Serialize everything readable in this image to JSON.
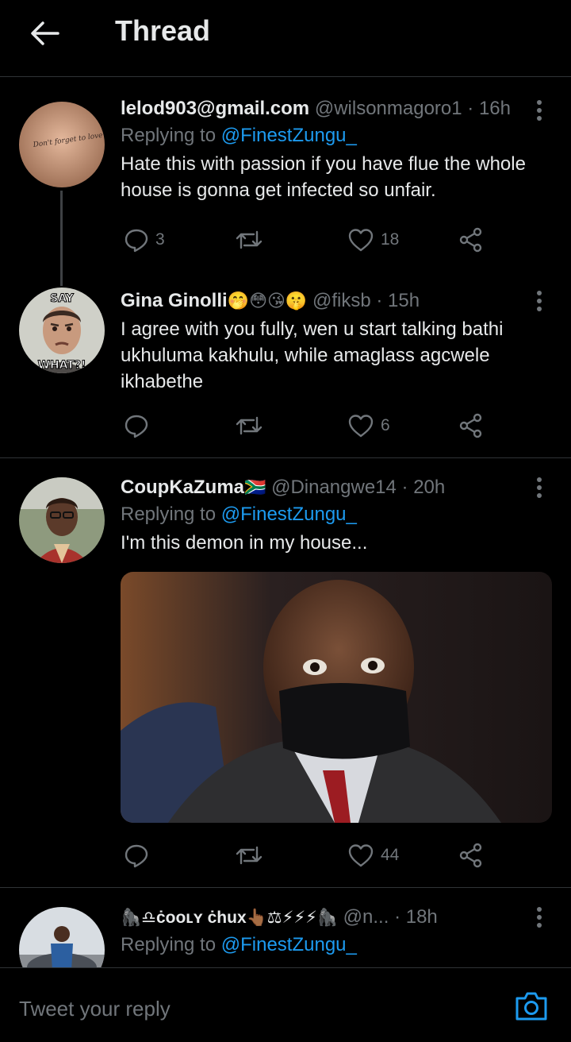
{
  "header": {
    "title": "Thread"
  },
  "tweets": [
    {
      "name": "lelod903@gmail.com",
      "name_emojis": "",
      "handle": "@wilsonmagoro1",
      "time": "· 16h",
      "reply_prefix": "Replying to ",
      "reply_to": "@FinestZungu_",
      "text": "Hate this with passion if you have flue the whole house is gonna get infected  so unfair.",
      "replies": "3",
      "retweets": "",
      "likes": "18",
      "avatar_text": "Don't forget to love yourself"
    },
    {
      "name": "Gina Ginolli",
      "name_emojis": "🤭😳😘🤫",
      "handle": "@fiksb",
      "time": "· 15h",
      "text": "I agree with you fully, wen u start talking bathi ukhuluma kakhulu, while amaglass agcwele ikhabethe",
      "replies": "",
      "retweets": "",
      "likes": "6",
      "avatar_top": "SAY",
      "avatar_bottom": "WHAT?!"
    },
    {
      "name": "CoupKaZuma",
      "name_emojis": "🇿🇦",
      "handle": "@Dinangwe14",
      "time": "· 20h",
      "reply_prefix": "Replying to ",
      "reply_to": "@FinestZungu_",
      "text": "I'm this demon in my house...",
      "replies": "",
      "retweets": "",
      "likes": "44"
    },
    {
      "name": "🦍♎ċooʟʏ ċhux👆🏾⚖⚡⚡⚡🦍",
      "handle": "@n...",
      "time": "· 18h",
      "reply_prefix": "Replying to ",
      "reply_to": "@FinestZungu_"
    }
  ],
  "composer": {
    "placeholder": "Tweet your reply"
  },
  "colors": {
    "accent": "#1d9bf0",
    "muted": "#71767b",
    "text": "#e7e9ea",
    "divider": "#2f3336"
  },
  "icons": [
    "back-arrow-icon",
    "more-vertical-icon",
    "reply-icon",
    "retweet-icon",
    "like-icon",
    "share-icon",
    "camera-icon"
  ]
}
